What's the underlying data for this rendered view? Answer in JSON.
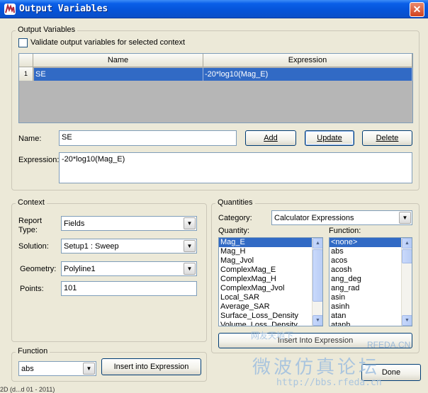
{
  "window": {
    "title": "Output Variables",
    "close_glyph": "✕"
  },
  "output_variables": {
    "legend": "Output Variables",
    "validate_label": "Validate output variables for selected context",
    "columns": [
      "Name",
      "Expression"
    ],
    "rows": [
      {
        "index": "1",
        "name": "SE",
        "expression": "-20*log10(Mag_E)"
      }
    ],
    "name_label": "Name:",
    "name_value": "SE",
    "expression_label": "Expression:",
    "expression_value": "-20*log10(Mag_E)",
    "add_label": "Add",
    "update_label": "Update",
    "delete_label": "Delete"
  },
  "context": {
    "legend": "Context",
    "report_type_label": "Report Type:",
    "report_type_value": "Fields",
    "solution_label": "Solution:",
    "solution_value": "Setup1 : Sweep",
    "geometry_label": "Geometry:",
    "geometry_value": "Polyline1",
    "points_label": "Points:",
    "points_value": "101"
  },
  "quantities": {
    "legend": "Quantities",
    "category_label": "Category:",
    "category_value": "Calculator Expressions",
    "quantity_label": "Quantity:",
    "function_label": "Function:",
    "quantity_items": [
      "Mag_E",
      "Mag_H",
      "Mag_Jvol",
      "ComplexMag_E",
      "ComplexMag_H",
      "ComplexMag_Jvol",
      "Local_SAR",
      "Average_SAR",
      "Surface_Loss_Density",
      "Volume_Loss_Density"
    ],
    "quantity_selected": "Mag_E",
    "function_items": [
      "<none>",
      "abs",
      "acos",
      "acosh",
      "ang_deg",
      "ang_rad",
      "asin",
      "asinh",
      "atan",
      "atanh"
    ],
    "function_selected": "<none>",
    "insert_label": "Insert Into Expression"
  },
  "function_group": {
    "legend": "Function",
    "value": "abs",
    "insert_label": "Insert into Expression"
  },
  "done_label": "Done",
  "watermark": {
    "cn1": "网友天地下",
    "site": "RFEDA.CN",
    "cn2": "微波仿真论坛",
    "url": "http://bbs.rfeda.cn"
  },
  "status_fragment": "2D (d...d 01 - 2011)"
}
